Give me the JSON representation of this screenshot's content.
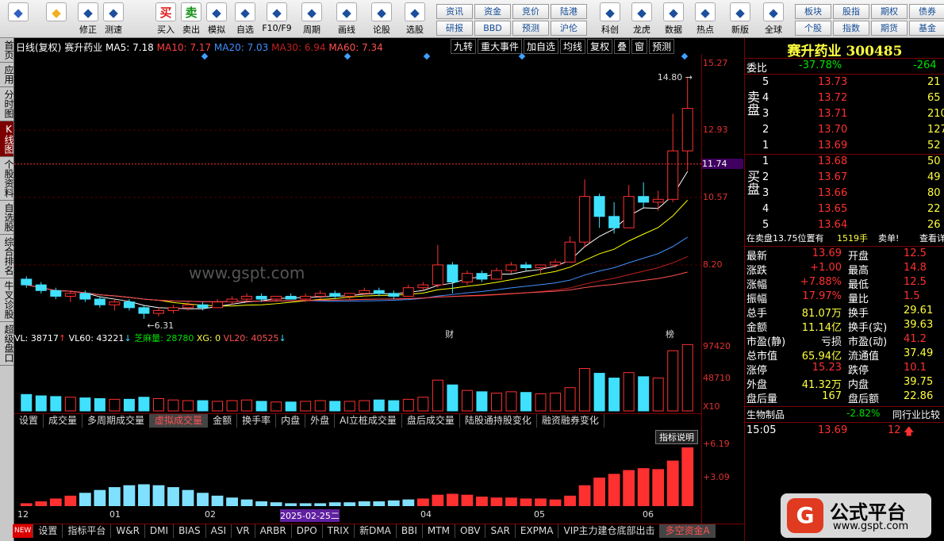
{
  "toolbar": {
    "buttons": [
      {
        "label": "",
        "icon": "grid-icon"
      },
      {
        "label": "",
        "icon": "back-arrow-icon"
      },
      {
        "label": "修正",
        "icon": "up-down-icon"
      },
      {
        "label": "测速",
        "icon": "clock-icon"
      },
      {
        "label": "买入",
        "icon": "buy-icon",
        "glyph": "买"
      },
      {
        "label": "卖出",
        "icon": "sell-icon",
        "glyph": "卖"
      },
      {
        "label": "模拟",
        "icon": "hammer-icon"
      },
      {
        "label": "自选",
        "icon": "star-icon"
      },
      {
        "label": "F10/F9",
        "icon": "f10-icon"
      },
      {
        "label": "周期",
        "icon": "cycle-icon"
      },
      {
        "label": "画线",
        "icon": "pencil-icon"
      },
      {
        "label": "论股",
        "icon": "discuss-icon"
      },
      {
        "label": "选股",
        "icon": "select-stock-icon"
      },
      {
        "label": "科创",
        "icon": "tech-icon"
      },
      {
        "label": "龙虎",
        "icon": "dragon-tiger-icon"
      },
      {
        "label": "数据",
        "icon": "pe-icon"
      },
      {
        "label": "热点",
        "icon": "hot-icon"
      },
      {
        "label": "新版",
        "icon": "new-version-icon"
      },
      {
        "label": "全球",
        "icon": "globe-icon"
      }
    ],
    "small_buttons": [
      "资讯",
      "资金",
      "竞价",
      "陆港",
      "研报",
      "BBD",
      "预测",
      "沪伦",
      "板块",
      "股指",
      "期权",
      "债券",
      "个股",
      "指数",
      "期货",
      "基金"
    ]
  },
  "sidebar": [
    "首页",
    "应用",
    "分时图",
    "K线图",
    "个股资料",
    "自选股",
    "综合排名",
    "牛叉诊股",
    "超级盘口"
  ],
  "chart": {
    "header": {
      "period": "日线(复权)",
      "name": "赛升药业",
      "ma5": "MA5: 7.18",
      "ma10": "MA10: 7.17",
      "ma20": "MA20: 7.03",
      "ma30": "MA30: 6.94",
      "ma60": "MA60: 7.34"
    },
    "header_buttons": [
      "九转",
      "重大事件",
      "加自选",
      "均线",
      "复权",
      "叠",
      "窗",
      "预测"
    ],
    "price_axis": [
      "15.27",
      "12.93",
      "11.74",
      "10.57",
      "8.20"
    ],
    "high_label": "14.80",
    "low_label": "6.31",
    "marker_cai": "财",
    "marker_bang": "榜",
    "watermark": "www.gspt.com",
    "vol_header": {
      "vl": "VL: 38717",
      "vl60": "VL60: 43221",
      "zml": "芝麻量: 28780",
      "xg": "XG: 0",
      "vl20": "VL20: 40525"
    },
    "vol_axis": [
      "97420",
      "48710",
      "X10"
    ],
    "vol_tabs": [
      "设置",
      "成交量",
      "多周期成交量",
      "虚拟成交量",
      "金额",
      "换手率",
      "内盘",
      "外盘",
      "AI立桩成交量",
      "盘后成交量",
      "陆股通持股变化",
      "融资融券变化"
    ],
    "ind_axis": [
      "+6.19",
      "+3.09"
    ],
    "ind_button": "指标说明",
    "months": [
      "12",
      "01",
      "02",
      "2025-02-25二",
      "04",
      "05",
      "06"
    ],
    "bottom_tabs": [
      "设置",
      "指标平台",
      "W&R",
      "DMI",
      "BIAS",
      "ASI",
      "VR",
      "ARBR",
      "DPO",
      "TRIX",
      "新DMA",
      "BBI",
      "MTM",
      "OBV",
      "SAR",
      "EXPMA",
      "VIP主力建仓底部出击",
      "多空资金A"
    ],
    "new_badge": "NEW"
  },
  "chart_data": {
    "type": "candlestick",
    "candles": [
      [
        7.7,
        7.8,
        7.4,
        7.5
      ],
      [
        7.5,
        7.6,
        7.2,
        7.3
      ],
      [
        7.3,
        7.4,
        7.0,
        7.1
      ],
      [
        7.1,
        7.3,
        6.9,
        7.2
      ],
      [
        7.2,
        7.3,
        6.9,
        7.0
      ],
      [
        7.0,
        7.1,
        6.7,
        6.8
      ],
      [
        6.8,
        7.0,
        6.6,
        6.9
      ],
      [
        6.9,
        7.0,
        6.6,
        6.7
      ],
      [
        6.7,
        6.8,
        6.31,
        6.5
      ],
      [
        6.5,
        6.7,
        6.4,
        6.6
      ],
      [
        6.6,
        6.8,
        6.5,
        6.7
      ],
      [
        6.7,
        6.9,
        6.6,
        6.8
      ],
      [
        6.8,
        6.9,
        6.6,
        6.7
      ],
      [
        6.7,
        7.0,
        6.7,
        6.9
      ],
      [
        6.9,
        7.1,
        6.8,
        7.0
      ],
      [
        7.0,
        7.2,
        6.9,
        7.1
      ],
      [
        7.1,
        7.2,
        6.9,
        7.0
      ],
      [
        7.0,
        7.1,
        6.9,
        7.1
      ],
      [
        7.1,
        7.2,
        7.0,
        7.0
      ],
      [
        7.0,
        7.2,
        6.9,
        7.1
      ],
      [
        7.1,
        7.3,
        7.0,
        7.2
      ],
      [
        7.2,
        7.3,
        7.0,
        7.1
      ],
      [
        7.1,
        7.2,
        7.0,
        7.2
      ],
      [
        7.2,
        7.4,
        7.1,
        7.3
      ],
      [
        7.3,
        7.4,
        7.1,
        7.2
      ],
      [
        7.2,
        7.3,
        7.0,
        7.1
      ],
      [
        7.1,
        7.5,
        7.1,
        7.4
      ],
      [
        7.4,
        7.6,
        7.3,
        7.5
      ],
      [
        7.5,
        8.9,
        7.4,
        8.2
      ],
      [
        8.2,
        8.3,
        7.2,
        7.6
      ],
      [
        7.6,
        8.0,
        7.5,
        7.9
      ],
      [
        7.9,
        8.0,
        7.6,
        7.7
      ],
      [
        7.7,
        8.1,
        7.7,
        8.0
      ],
      [
        8.0,
        8.3,
        7.9,
        8.2
      ],
      [
        8.2,
        8.3,
        8.0,
        8.1
      ],
      [
        8.1,
        8.2,
        7.9,
        8.2
      ],
      [
        8.2,
        8.4,
        8.1,
        8.3
      ],
      [
        8.3,
        9.2,
        8.3,
        9.0
      ],
      [
        9.0,
        11.2,
        8.8,
        10.6
      ],
      [
        10.6,
        10.7,
        9.5,
        9.9
      ],
      [
        9.9,
        10.4,
        9.3,
        9.5
      ],
      [
        9.5,
        11.0,
        9.5,
        10.6
      ],
      [
        10.6,
        11.1,
        10.2,
        10.4
      ],
      [
        10.4,
        10.8,
        10.1,
        10.5
      ],
      [
        10.5,
        13.5,
        10.4,
        12.2
      ],
      [
        12.2,
        14.8,
        11.5,
        13.69
      ]
    ],
    "volume_max": 97420,
    "indicator_max": 6.19,
    "current_price": "11.74"
  },
  "quote": {
    "name": "赛升药业 300485",
    "weibi": {
      "label": "委比",
      "pct": "-37.78%",
      "diff": "-264"
    },
    "sell_label": "卖盘",
    "buy_label": "买盘",
    "sell": [
      [
        "5",
        "13.73",
        "21"
      ],
      [
        "4",
        "13.72",
        "65"
      ],
      [
        "3",
        "13.71",
        "210"
      ],
      [
        "2",
        "13.70",
        "127"
      ],
      [
        "1",
        "13.69",
        "52"
      ]
    ],
    "buy": [
      [
        "1",
        "13.68",
        "50"
      ],
      [
        "2",
        "13.67",
        "49"
      ],
      [
        "3",
        "13.66",
        "80"
      ],
      [
        "4",
        "13.65",
        "22"
      ],
      [
        "5",
        "13.64",
        "26"
      ]
    ],
    "position": {
      "text": "在卖盘13.75位置有",
      "qty": "1519手",
      "action": "卖单!",
      "link": "查看详"
    },
    "stats": [
      [
        "最新",
        "13.69",
        "开盘",
        "12.5"
      ],
      [
        "涨跌",
        "+1.00",
        "最高",
        "14.8"
      ],
      [
        "涨幅",
        "+7.88%",
        "最低",
        "12.5"
      ],
      [
        "振幅",
        "17.97%",
        "量比",
        "1.5"
      ],
      [
        "总手",
        "81.07万",
        "换手",
        "29.61"
      ],
      [
        "金额",
        "11.14亿",
        "换手(实)",
        "39.63"
      ],
      [
        "市盈(静)",
        "亏损",
        "市盈(动)",
        "41.2"
      ],
      [
        "总市值",
        "65.94亿",
        "流通值",
        "37.49"
      ],
      [
        "涨停",
        "15.23",
        "跌停",
        "10.1"
      ],
      [
        "外盘",
        "41.32万",
        "内盘",
        "39.75"
      ],
      [
        "盘后量",
        "167",
        "盘后额",
        "22.86"
      ]
    ],
    "industry": {
      "name": "生物制品",
      "pct": "-2.82%",
      "rank": "同行业比较"
    },
    "tick": {
      "time": "15:05",
      "price": "13.69",
      "vol": "12"
    }
  },
  "logo": {
    "text": "公式平台",
    "url": "www.gspt.com"
  }
}
